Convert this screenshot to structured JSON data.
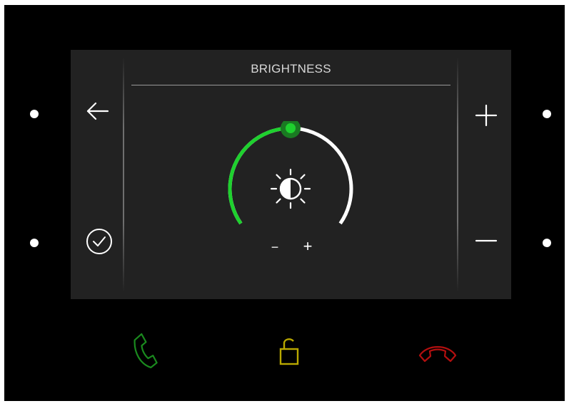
{
  "screen": {
    "title": "BRIGHTNESS"
  },
  "brightness": {
    "level_fraction": 0.5,
    "minus_label": "−",
    "plus_label": "+"
  },
  "colors": {
    "accent_green": "#1ed12e",
    "call_green": "#1a8a1e",
    "unlock_yellow": "#b9a800",
    "hangup_red": "#b30f0f",
    "screen_bg": "#222222"
  },
  "icons": {
    "back": "arrow-left-icon",
    "confirm": "check-circle-icon",
    "increase": "plus-icon",
    "decrease": "minus-icon",
    "brightness": "brightness-contrast-icon",
    "answer": "phone-answer-icon",
    "unlock": "unlock-icon",
    "hangup": "phone-hangup-icon"
  }
}
